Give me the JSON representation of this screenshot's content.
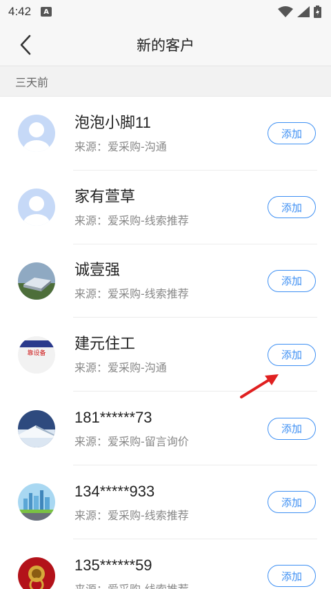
{
  "status": {
    "time": "4:42",
    "badge": "A"
  },
  "header": {
    "title": "新的客户"
  },
  "section": {
    "label": "三天前"
  },
  "customers": [
    {
      "name": "泡泡小脚11",
      "source": "来源：爱采购-沟通",
      "action": "添加",
      "avatar": "default-avatar"
    },
    {
      "name": "家有萱草",
      "source": "来源：爱采购-线索推荐",
      "action": "添加",
      "avatar": "default-avatar"
    },
    {
      "name": "诚壹强",
      "source": "来源：爱采购-线索推荐",
      "action": "添加",
      "avatar": "building-photo"
    },
    {
      "name": "建元住工",
      "source": "来源：爱采购-沟通",
      "action": "添加",
      "avatar": "logo-image",
      "avatar_text": "靠设备"
    },
    {
      "name": "181******73",
      "source": "来源：爱采购-留言询价",
      "action": "添加",
      "avatar": "snow-roof-photo"
    },
    {
      "name": "134*****933",
      "source": "来源：爱采购-线索推荐",
      "action": "添加",
      "avatar": "city-skyline"
    },
    {
      "name": "135******59",
      "source": "来源：爱采购-线索推荐",
      "action": "添加",
      "avatar": "red-door-knocker"
    }
  ],
  "colors": {
    "accent": "#3d8ff3",
    "arrow": "#e02020",
    "default_avatar": "#c6d9f7"
  }
}
